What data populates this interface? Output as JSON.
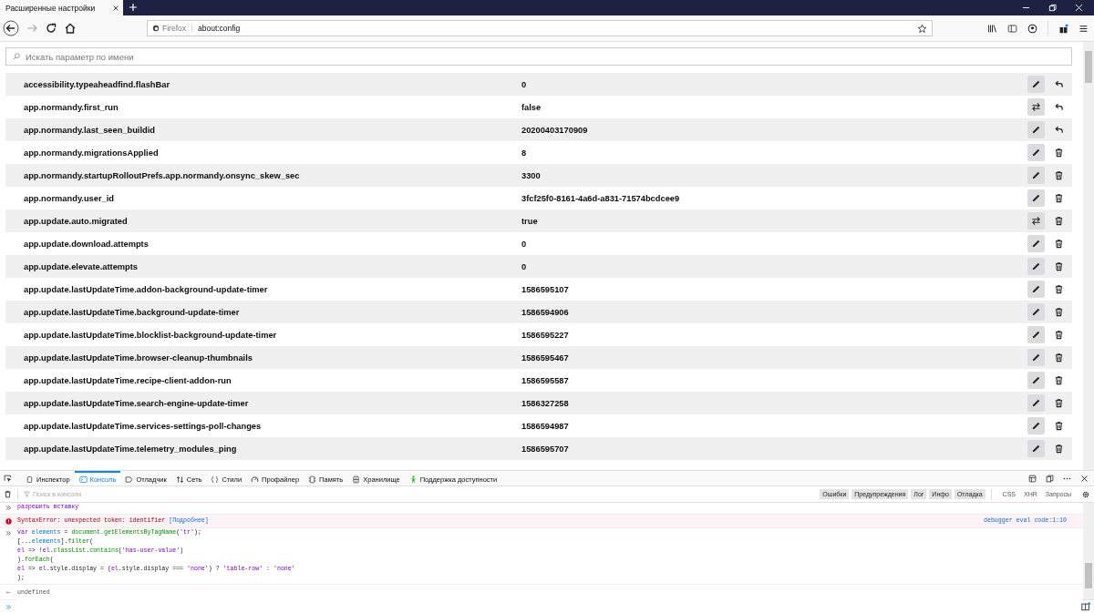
{
  "tab": {
    "title": "Расширенные настройки",
    "selected": true
  },
  "urlbar": {
    "identity": "Firefox",
    "url": "about:config"
  },
  "search": {
    "placeholder": "Искать параметр по имени"
  },
  "prefs": [
    {
      "name": "accessibility.typeaheadfind.flashBar",
      "value": "0",
      "buttons": [
        {
          "kind": "edit"
        },
        {
          "kind": "reset"
        }
      ]
    },
    {
      "name": "app.normandy.first_run",
      "value": "false",
      "buttons": [
        {
          "kind": "toggle"
        },
        {
          "kind": "reset"
        }
      ]
    },
    {
      "name": "app.normandy.last_seen_buildid",
      "value": "20200403170909",
      "buttons": [
        {
          "kind": "edit"
        },
        {
          "kind": "reset"
        }
      ]
    },
    {
      "name": "app.normandy.migrationsApplied",
      "value": "8",
      "buttons": [
        {
          "kind": "edit"
        },
        {
          "kind": "delete"
        }
      ]
    },
    {
      "name": "app.normandy.startupRolloutPrefs.app.normandy.onsync_skew_sec",
      "value": "3300",
      "buttons": [
        {
          "kind": "edit"
        },
        {
          "kind": "delete"
        }
      ]
    },
    {
      "name": "app.normandy.user_id",
      "value": "3fcf25f0-8161-4a6d-a831-71574bcdcee9",
      "buttons": [
        {
          "kind": "edit"
        },
        {
          "kind": "delete"
        }
      ]
    },
    {
      "name": "app.update.auto.migrated",
      "value": "true",
      "buttons": [
        {
          "kind": "toggle"
        },
        {
          "kind": "delete"
        }
      ]
    },
    {
      "name": "app.update.download.attempts",
      "value": "0",
      "buttons": [
        {
          "kind": "edit"
        },
        {
          "kind": "delete"
        }
      ]
    },
    {
      "name": "app.update.elevate.attempts",
      "value": "0",
      "buttons": [
        {
          "kind": "edit"
        },
        {
          "kind": "delete"
        }
      ]
    },
    {
      "name": "app.update.lastUpdateTime.addon-background-update-timer",
      "value": "1586595107",
      "buttons": [
        {
          "kind": "edit"
        },
        {
          "kind": "delete"
        }
      ]
    },
    {
      "name": "app.update.lastUpdateTime.background-update-timer",
      "value": "1586594906",
      "buttons": [
        {
          "kind": "edit"
        },
        {
          "kind": "delete"
        }
      ]
    },
    {
      "name": "app.update.lastUpdateTime.blocklist-background-update-timer",
      "value": "1586595227",
      "buttons": [
        {
          "kind": "edit"
        },
        {
          "kind": "delete"
        }
      ]
    },
    {
      "name": "app.update.lastUpdateTime.browser-cleanup-thumbnails",
      "value": "1586595467",
      "buttons": [
        {
          "kind": "edit"
        },
        {
          "kind": "delete"
        }
      ]
    },
    {
      "name": "app.update.lastUpdateTime.recipe-client-addon-run",
      "value": "1586595587",
      "buttons": [
        {
          "kind": "edit"
        },
        {
          "kind": "delete"
        }
      ]
    },
    {
      "name": "app.update.lastUpdateTime.search-engine-update-timer",
      "value": "1586327258",
      "buttons": [
        {
          "kind": "edit"
        },
        {
          "kind": "delete"
        }
      ]
    },
    {
      "name": "app.update.lastUpdateTime.services-settings-poll-changes",
      "value": "1586594987",
      "buttons": [
        {
          "kind": "edit"
        },
        {
          "kind": "delete"
        }
      ]
    },
    {
      "name": "app.update.lastUpdateTime.telemetry_modules_ping",
      "value": "1586595707",
      "buttons": [
        {
          "kind": "edit"
        },
        {
          "kind": "delete"
        }
      ]
    }
  ],
  "devtools": {
    "tabs": [
      {
        "label": "Инспектор",
        "kind": "inspector",
        "selected": false
      },
      {
        "label": "Консоль",
        "kind": "console",
        "selected": true
      },
      {
        "label": "Отладчик",
        "kind": "debugger",
        "selected": false
      },
      {
        "label": "Сеть",
        "kind": "network",
        "selected": false
      },
      {
        "label": "Стили",
        "kind": "styles",
        "selected": false
      },
      {
        "label": "Профайлер",
        "kind": "profiler",
        "selected": false
      },
      {
        "label": "Память",
        "kind": "memory",
        "selected": false
      },
      {
        "label": "Хранилище",
        "kind": "storage",
        "selected": false
      },
      {
        "label": "Поддержка доступности",
        "kind": "accessibility",
        "selected": false
      }
    ],
    "filter_placeholder": "Поиск в консоли",
    "levels": [
      {
        "label": "Ошибки",
        "selected": true
      },
      {
        "label": "Предупреждения",
        "selected": true
      },
      {
        "label": "Лог",
        "selected": true
      },
      {
        "label": "Инфо",
        "selected": true
      },
      {
        "label": "Отладка",
        "selected": true
      }
    ],
    "types": [
      {
        "label": "CSS",
        "selected": false
      },
      {
        "label": "XHR",
        "selected": false
      },
      {
        "label": "Запросы",
        "selected": false
      }
    ],
    "messages": [
      {
        "kind": "input",
        "lines": [
          [
            {
              "text": "разрешить вставку",
              "kind": "kw"
            }
          ]
        ]
      },
      {
        "kind": "error",
        "text": "SyntaxError: unexpected token: identifier",
        "link": "[Подробнее]",
        "location": "debugger eval code:1:10"
      },
      {
        "kind": "input",
        "lines": [
          [
            {
              "text": "var",
              "kind": "kw"
            },
            {
              "text": " elements",
              "kind": "var"
            },
            {
              "text": " = ",
              "kind": "pl"
            },
            {
              "text": "document.getElementsByTagName",
              "kind": "prop"
            },
            {
              "text": "(",
              "kind": "pl"
            },
            {
              "text": "'tr'",
              "kind": "str"
            },
            {
              "text": ");",
              "kind": "pl"
            }
          ],
          [
            {
              "text": "[...",
              "kind": "pl"
            },
            {
              "text": "elements",
              "kind": "var"
            },
            {
              "text": "].",
              "kind": "pl"
            },
            {
              "text": "filter",
              "kind": "prop"
            },
            {
              "text": "(",
              "kind": "pl"
            }
          ],
          [
            {
              "text": "el",
              "kind": "kw"
            },
            {
              "text": " => !",
              "kind": "pl"
            },
            {
              "text": "el",
              "kind": "kw"
            },
            {
              "text": ".",
              "kind": "pl"
            },
            {
              "text": "classList",
              "kind": "prop"
            },
            {
              "text": ".",
              "kind": "pl"
            },
            {
              "text": "contains",
              "kind": "prop"
            },
            {
              "text": "(",
              "kind": "pl"
            },
            {
              "text": "'has-user-value'",
              "kind": "str"
            },
            {
              "text": ")",
              "kind": "pl"
            }
          ],
          [
            {
              "text": ").",
              "kind": "pl"
            },
            {
              "text": "forEach",
              "kind": "prop"
            },
            {
              "text": "(",
              "kind": "pl"
            }
          ],
          [
            {
              "text": "el",
              "kind": "kw"
            },
            {
              "text": " => ",
              "kind": "pl"
            },
            {
              "text": "el",
              "kind": "kw"
            },
            {
              "text": ".style.display = (",
              "kind": "pl"
            },
            {
              "text": "el",
              "kind": "kw"
            },
            {
              "text": ".style.display === ",
              "kind": "pl"
            },
            {
              "text": "'none'",
              "kind": "str"
            },
            {
              "text": ") ? ",
              "kind": "pl"
            },
            {
              "text": "'table-row'",
              "kind": "str"
            },
            {
              "text": " : ",
              "kind": "pl"
            },
            {
              "text": "'none'",
              "kind": "str"
            }
          ],
          [
            {
              "text": ");",
              "kind": "pl"
            }
          ]
        ]
      },
      {
        "kind": "result",
        "text": "undefined"
      }
    ]
  }
}
